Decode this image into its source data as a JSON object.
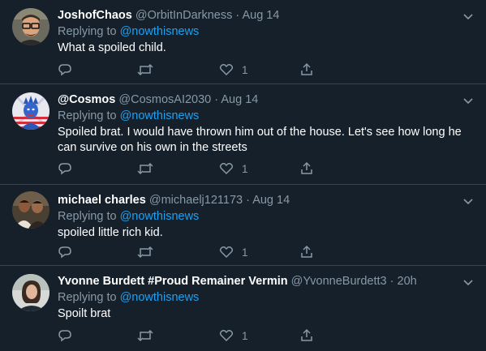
{
  "replying_prefix": "Replying to",
  "tweets": [
    {
      "name": "JoshofChaos",
      "handle": "@OrbitInDarkness",
      "time": "Aug 14",
      "replying_to": "@nowthisnews",
      "text": "What a spoiled child.",
      "like_count": "1",
      "avatar_icon": "avatar-man-glasses"
    },
    {
      "name": "@Cosmos",
      "handle": "@CosmosAI2030",
      "time": "Aug 14",
      "replying_to": "@nowthisnews",
      "text": "Spoiled brat. I would have thrown him out of the house. Let's see how long he can survive on his own in the streets",
      "like_count": "1",
      "avatar_icon": "avatar-statue-of-liberty"
    },
    {
      "name": "michael charles",
      "handle": "@michaelj121173",
      "time": "Aug 14",
      "replying_to": "@nowthisnews",
      "text": "spoiled little rich kid.",
      "like_count": "1",
      "avatar_icon": "avatar-two-people"
    },
    {
      "name": "Yvonne Burdett #Proud Remainer Vermin",
      "handle": "@YvonneBurdett3",
      "time": "20h",
      "replying_to": "@nowthisnews",
      "text": "Spoilt brat",
      "like_count": "1",
      "avatar_icon": "avatar-woman"
    }
  ],
  "colors": {
    "background": "#15202b",
    "divider": "#38444d",
    "secondary_text": "#8899a6",
    "link": "#1da1f2"
  },
  "icons": {
    "reply": "reply-icon",
    "retweet": "retweet-icon",
    "like": "heart-icon",
    "share": "share-icon",
    "more": "chevron-down-icon"
  }
}
